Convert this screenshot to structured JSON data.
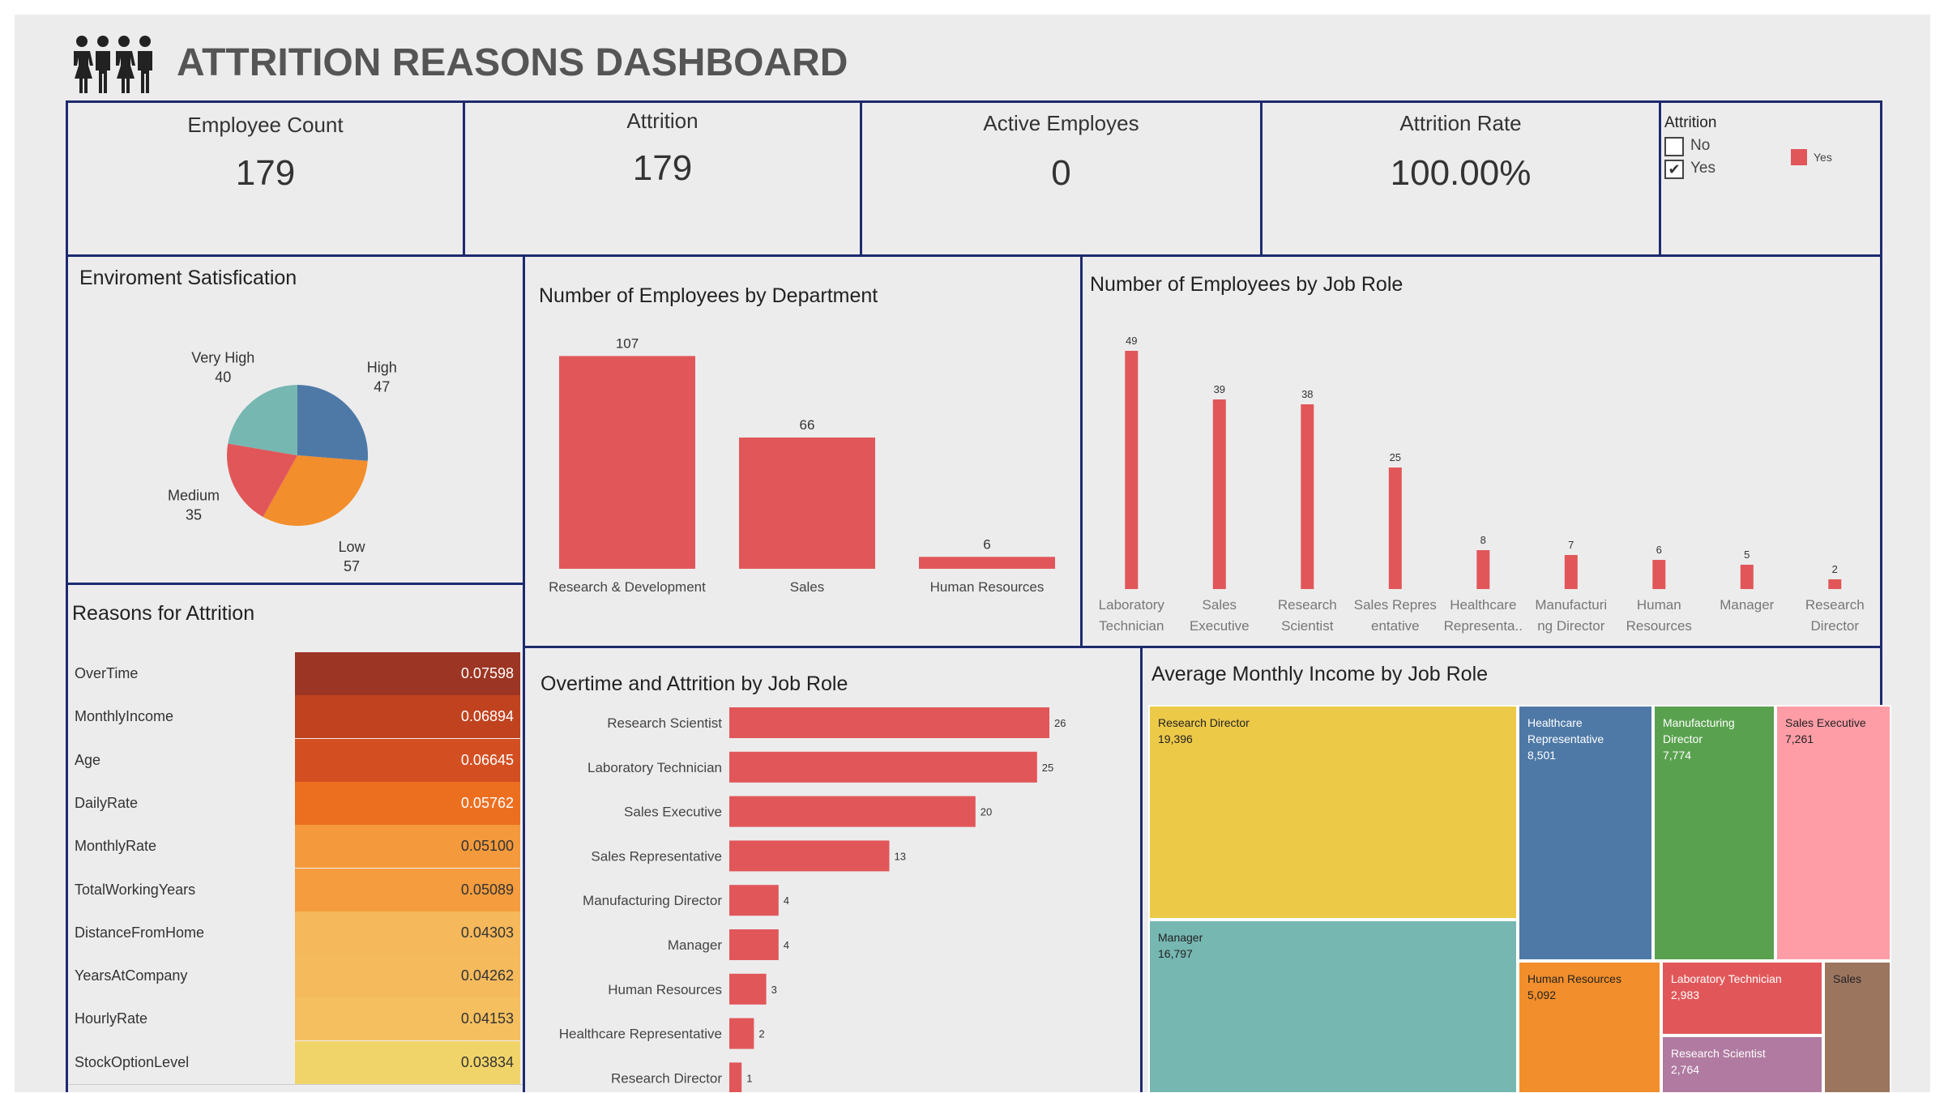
{
  "dashboard_title": "ATTRITION REASONS DASHBOARD",
  "colors": {
    "accent": "#e15759",
    "border": "#1e2a6e",
    "background": "#ececed"
  },
  "kpis": [
    {
      "title": "Employee Count",
      "value": "179"
    },
    {
      "title": "Attrition",
      "value": "179"
    },
    {
      "title": "Active Employes",
      "value": "0"
    },
    {
      "title": "Attrition Rate",
      "value": "100.00%"
    }
  ],
  "filter": {
    "title": "Attrition",
    "options": [
      {
        "label": "No",
        "checked": false
      },
      {
        "label": "Yes",
        "checked": true
      }
    ],
    "legend_label": "Yes"
  },
  "environment_panel": {
    "title": "Enviroment Satisfication"
  },
  "department_panel": {
    "title": "Number of Employees by Department"
  },
  "jobrole_panel": {
    "title": "Number of Employees by Job Role"
  },
  "reasons_panel": {
    "title": "Reasons for Attrition"
  },
  "overtime_panel": {
    "title": "Overtime and Attrition by Job Role"
  },
  "income_panel": {
    "title": "Average Monthly Income by Job Role"
  },
  "chart_data": [
    {
      "type": "pie",
      "title": "Enviroment Satisfication",
      "slices": [
        {
          "label": "High",
          "value": 47,
          "color": "#4e79a7"
        },
        {
          "label": "Low",
          "value": 57,
          "color": "#f28e2b"
        },
        {
          "label": "Medium",
          "value": 35,
          "color": "#e15759"
        },
        {
          "label": "Very High",
          "value": 40,
          "color": "#76b7b2"
        }
      ]
    },
    {
      "type": "bar",
      "title": "Number of Employees by Department",
      "categories": [
        "Research & Development",
        "Sales",
        "Human Resources"
      ],
      "values": [
        107,
        66,
        6
      ],
      "ylim": [
        0,
        110
      ]
    },
    {
      "type": "bar",
      "title": "Number of Employees by Job Role",
      "categories": [
        "Laboratory Technician",
        "Sales Executive",
        "Research Scientist",
        "Sales Representative",
        "Healthcare Representative",
        "Manufacturing Director",
        "Human Resources",
        "Manager",
        "Research Director"
      ],
      "tick_labels": [
        [
          "Laboratory",
          "Technician"
        ],
        [
          "Sales",
          "Executive"
        ],
        [
          "Research",
          "Scientist"
        ],
        [
          "Sales Repres",
          "entative"
        ],
        [
          "Healthcare",
          "Representa.."
        ],
        [
          "Manufacturi",
          "ng Director"
        ],
        [
          "Human",
          "Resources"
        ],
        [
          "Manager"
        ],
        [
          "Research",
          "Director"
        ]
      ],
      "values": [
        49,
        39,
        38,
        25,
        8,
        7,
        6,
        5,
        2
      ],
      "ylim": [
        0,
        50
      ]
    },
    {
      "type": "table",
      "title": "Reasons for Attrition",
      "rows": [
        {
          "feature": "OverTime",
          "value": "0.07598",
          "color": "#9c3523",
          "text_color": "#ffffff"
        },
        {
          "feature": "MonthlyIncome",
          "value": "0.06894",
          "color": "#c0421f",
          "text_color": "#ffffff"
        },
        {
          "feature": "Age",
          "value": "0.06645",
          "color": "#d34f22",
          "text_color": "#ffffff"
        },
        {
          "feature": "DailyRate",
          "value": "0.05762",
          "color": "#ec6f20",
          "text_color": "#ffffff"
        },
        {
          "feature": "MonthlyRate",
          "value": "0.05100",
          "color": "#f49a3c",
          "text_color": "#333333"
        },
        {
          "feature": "TotalWorkingYears",
          "value": "0.05089",
          "color": "#f49c3e",
          "text_color": "#333333"
        },
        {
          "feature": "DistanceFromHome",
          "value": "0.04303",
          "color": "#f5b85a",
          "text_color": "#333333"
        },
        {
          "feature": "YearsAtCompany",
          "value": "0.04262",
          "color": "#f5ba5c",
          "text_color": "#333333"
        },
        {
          "feature": "HourlyRate",
          "value": "0.04153",
          "color": "#f5bf5f",
          "text_color": "#333333"
        },
        {
          "feature": "StockOptionLevel",
          "value": "0.03834",
          "color": "#f1d469",
          "text_color": "#333333"
        }
      ]
    },
    {
      "type": "bar",
      "orientation": "horizontal",
      "title": "Overtime and Attrition by Job Role",
      "categories": [
        "Research Scientist",
        "Laboratory Technician",
        "Sales Executive",
        "Sales Representative",
        "Manufacturing Director",
        "Manager",
        "Human Resources",
        "Healthcare Representative",
        "Research Director"
      ],
      "values": [
        26,
        25,
        20,
        13,
        4,
        4,
        3,
        2,
        1
      ],
      "xlim": [
        0,
        26
      ]
    },
    {
      "type": "treemap",
      "title": "Average Monthly Income by Job Role",
      "items": [
        {
          "label": "Research Director",
          "value": "19,396",
          "color": "#edc948"
        },
        {
          "label": "Manager",
          "value": "16,797",
          "color": "#76b7b2"
        },
        {
          "label": "Healthcare Representative",
          "value": "8,501",
          "color": "#4e79a7"
        },
        {
          "label": "Manufacturing Director",
          "value": "7,774",
          "color": "#59a14f"
        },
        {
          "label": "Sales Executive",
          "value": "7,261",
          "color": "#ff9da7"
        },
        {
          "label": "Human Resources",
          "value": "5,092",
          "color": "#f28e2b"
        },
        {
          "label": "Laboratory Technician",
          "value": "2,983",
          "color": "#e15759"
        },
        {
          "label": "Research Scientist",
          "value": "2,764",
          "color": "#b07aa1"
        },
        {
          "label": "Sales",
          "value": "",
          "color": "#9c755f"
        }
      ]
    }
  ]
}
